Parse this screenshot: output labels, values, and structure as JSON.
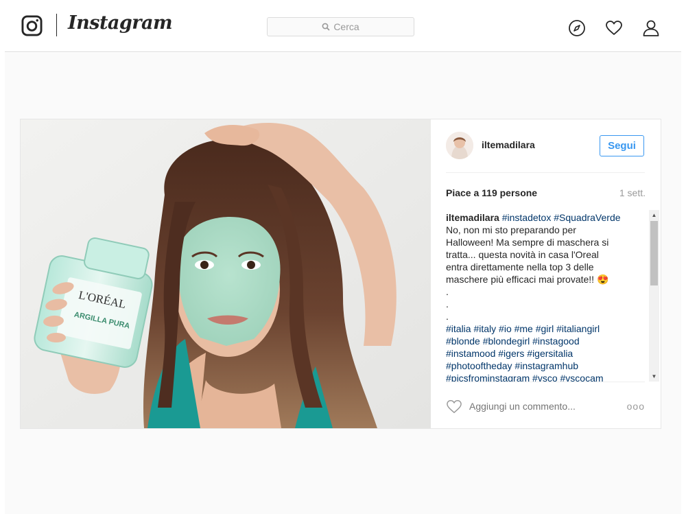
{
  "header": {
    "brand": "Instagram",
    "search": {
      "placeholder": "Cerca"
    },
    "icons": [
      "instagram-logo-icon",
      "compass-icon",
      "heart-icon",
      "profile-icon"
    ]
  },
  "post": {
    "username": "iltemadilara",
    "follow_label": "Segui",
    "likes": "Piace a 119 persone",
    "time": "1 sett.",
    "caption": {
      "username": "iltemadilara",
      "hashtags_inline": [
        "#instadetox",
        "#SquadraVerde"
      ],
      "lines": [
        "No, non mi sto preparando per",
        "Halloween! Ma sempre di maschera si",
        "tratta... questa novità in casa l'Oreal",
        "entra direttamente nella top 3 delle",
        "maschere più efficaci mai provate!! 😍"
      ],
      "dots": [
        ".",
        ".",
        "."
      ],
      "tag_lines": [
        "#italia #italy #io #me #girl #italiangirl",
        "#blonde #blondegirl #instagood",
        "#instamood #igers #igersitalia",
        "#photooftheday #instagramhub",
        "#picsfrominstagram #vsco #vscocam"
      ]
    },
    "comment_placeholder": "Aggiungi un commento...",
    "more_label": "ooo"
  },
  "photo": {
    "product_brand": "L'ORÉAL",
    "product_name": "ARGILLA PURA"
  },
  "colors": {
    "accent": "#3897f0",
    "hashtag": "#003569",
    "mask": "#a9dcc4",
    "top": "#1a9a93",
    "hair": "#5a3525"
  }
}
